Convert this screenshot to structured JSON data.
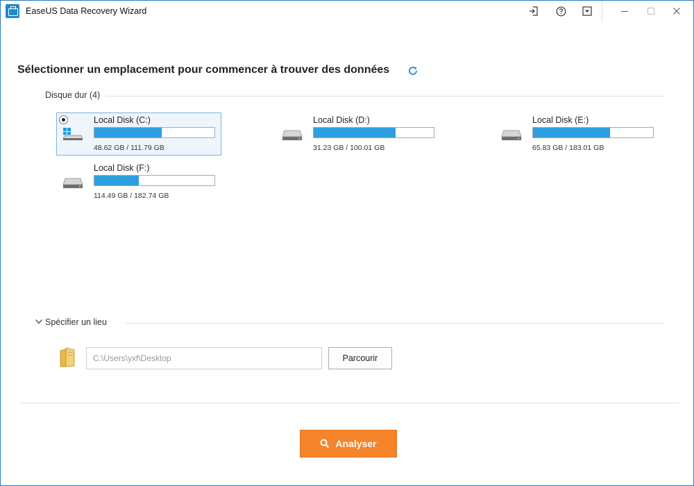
{
  "window": {
    "title": "EaseUS Data Recovery Wizard"
  },
  "heading": "Sélectionner un emplacement pour commencer à trouver des données",
  "drives_section": {
    "label": "Disque dur (4)",
    "disks": [
      {
        "name": "Local Disk (C:)",
        "size": "48.62 GB / 111.79 GB",
        "used_fraction": 0.56,
        "system": true,
        "selected": true
      },
      {
        "name": "Local Disk (D:)",
        "size": "31.23 GB / 100.01 GB",
        "used_fraction": 0.68
      },
      {
        "name": "Local Disk (E:)",
        "size": "65.83 GB / 183.01 GB",
        "used_fraction": 0.64
      },
      {
        "name": "Local Disk (F:)",
        "size": "114.49 GB / 182.74 GB",
        "used_fraction": 0.37
      }
    ]
  },
  "location_section": {
    "label": "Spécifier un lieu",
    "path_value": "C:\\Users\\yxf\\Desktop",
    "browse_label": "Parcourir"
  },
  "scan_button": {
    "label": "Analyser"
  },
  "colors": {
    "accent": "#f5842b",
    "bar_fill": "#2d9fe0",
    "selection": "#eef5fc",
    "title_icon": "#1e88c8"
  },
  "icons": {
    "app": "easeus-app-icon",
    "signin": "sign-in-icon",
    "help": "help-icon",
    "menu": "dropdown-menu-icon",
    "minimize": "minimize-icon",
    "maximize": "maximize-icon",
    "close": "close-icon",
    "refresh": "refresh-icon",
    "drive": "hard-drive-icon",
    "windows": "windows-logo-icon",
    "folder": "folder-icon",
    "search": "search-icon",
    "chevron": "chevron-down-icon"
  }
}
